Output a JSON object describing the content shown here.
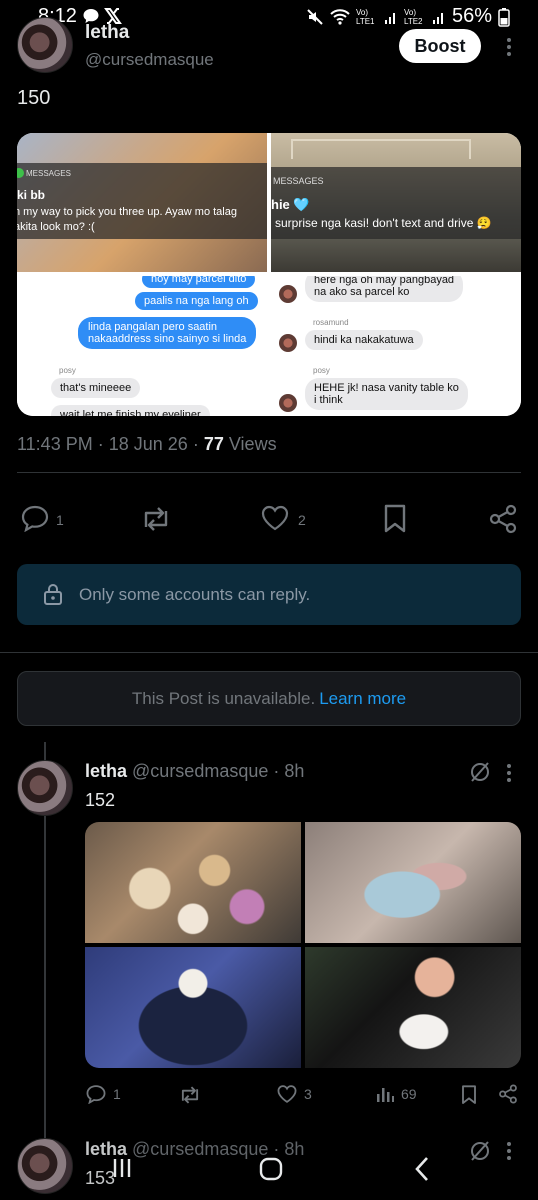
{
  "status_bar": {
    "time": "8:12",
    "net1": "Vo) LTE1",
    "net2": "Vo) LTE2",
    "battery": "56%"
  },
  "post": {
    "display_name": "letha",
    "handle": "@cursedmasque",
    "boost_label": "Boost",
    "text": "150",
    "meta_time": "11:43 PM",
    "meta_date": "18 Jun 26",
    "views_count": "77",
    "views_label": "Views",
    "reply_count": "1",
    "like_count": "2",
    "media": {
      "tile1": {
        "app": "MESSAGES",
        "sender": "ki bb",
        "line1": "n my way to pick you three up. Ayaw mo talag",
        "line2": "akita look mo? :("
      },
      "tile2": {
        "app": "MESSAGES",
        "sender": "hie 🩵",
        "line1": "surprise nga kasi! don't text and drive 😮‍💨"
      },
      "tile3": {
        "b1": "hoy may parcel dito",
        "b2": "paalis na nga lang oh",
        "b3a": "linda pangalan pero saatin",
        "b3b": "nakaaddress sino sainyo si linda",
        "label": "posy",
        "g1": "that's mineeee",
        "g2": "wait let me finish my eyeliner"
      },
      "tile4": {
        "g1a": "here nga oh may pangbayad",
        "g1b": "na  ako sa parcel ko",
        "label1": "rosamund",
        "g2": "hindi ka nakakatuwa",
        "label2": "posy",
        "g3a": "HEHE jk! nasa vanity table ko",
        "g3b": "i think"
      }
    }
  },
  "restricted_notice": "Only some accounts can reply.",
  "unavailable": {
    "text": "This Post is unavailable.",
    "link": "Learn more"
  },
  "reply1": {
    "display_name": "letha",
    "handle": "@cursedmasque",
    "time": "8h",
    "text": "152",
    "reply_count": "1",
    "like_count": "3",
    "views": "69"
  },
  "reply2": {
    "display_name": "letha",
    "handle": "@cursedmasque",
    "time": "8h",
    "text": "153"
  },
  "colors": {
    "accent": "#1d9bf0",
    "muted": "#71767b",
    "restricted_bg": "#0c2a3a"
  }
}
